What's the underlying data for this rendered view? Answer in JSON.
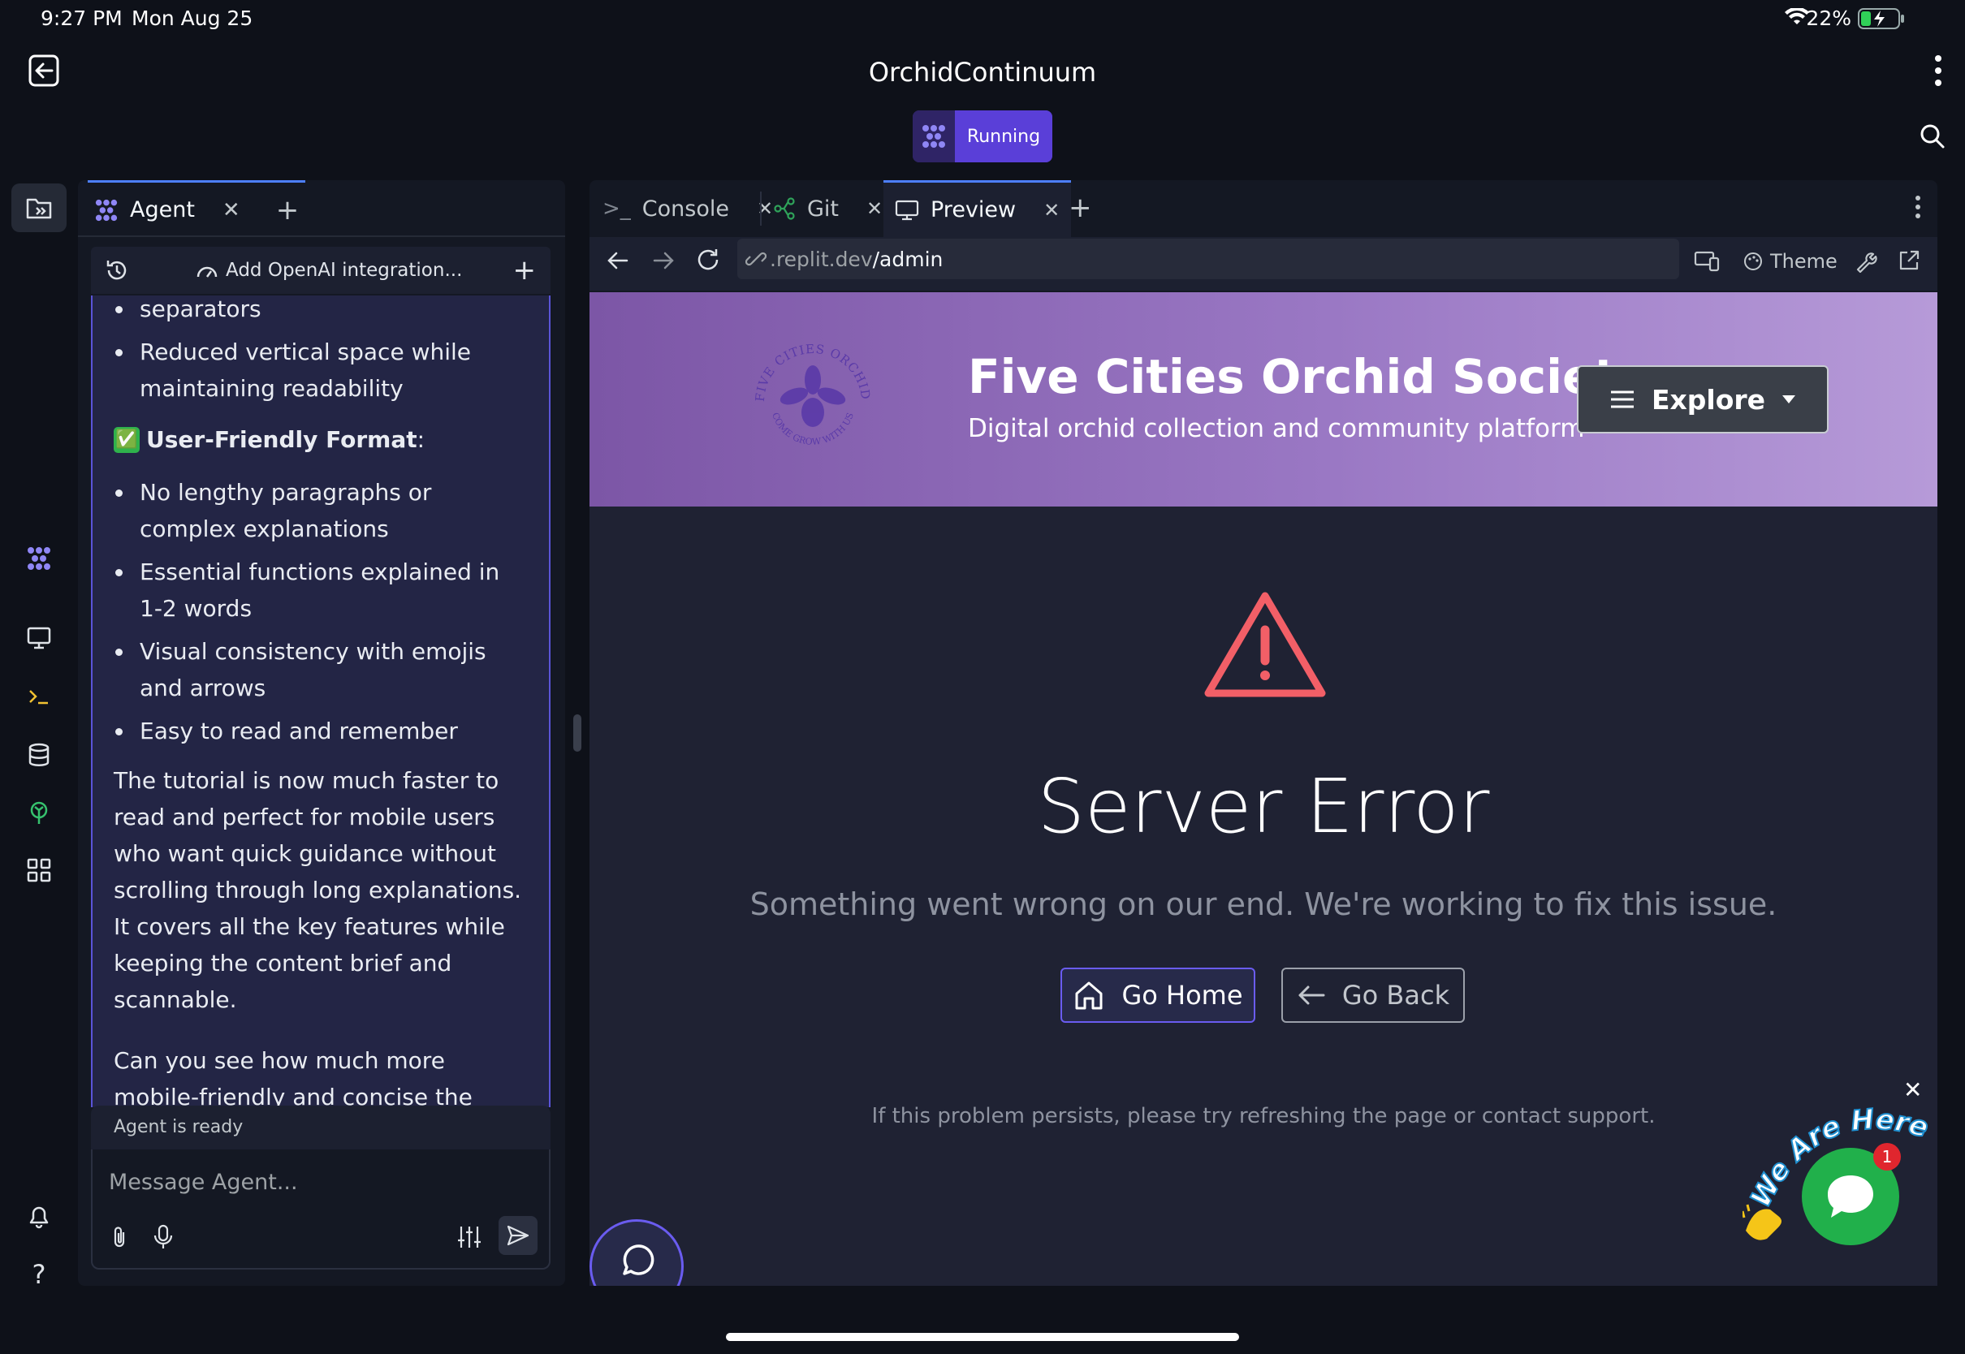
{
  "status_bar": {
    "time": "9:27 PM",
    "date": "Mon Aug 25",
    "battery": "22%"
  },
  "app": {
    "title": "OrchidContinuum",
    "run_status": "Running"
  },
  "agent_panel": {
    "tab_label": "Agent",
    "thread_title": "Add OpenAI integration...",
    "messages": {
      "partial_bullet": "separators",
      "bullet_reduced": "Reduced vertical space while maintaining readability",
      "heading_emoji": "✅",
      "heading": "User-Friendly Format",
      "heading_colon": ":",
      "bullets": [
        "No lengthy paragraphs or complex explanations",
        "Essential functions explained in 1-2 words",
        "Visual consistency with emojis and arrows",
        "Easy to read and remember"
      ],
      "paragraph_1": "The tutorial is now much faster to read and perfect for mobile users who want quick guidance without scrolling through long explanations. It covers all the key features while keeping the content brief and scannable.",
      "paragraph_2": "Can you see how much more mobile-friendly and concise the tutorial has"
    },
    "status": "Agent is ready",
    "input_placeholder": "Message Agent..."
  },
  "preview_panel": {
    "tabs": [
      {
        "label": "Console",
        "icon": "terminal-icon"
      },
      {
        "label": "Git",
        "icon": "git-icon"
      },
      {
        "label": "Preview",
        "icon": "monitor-icon"
      }
    ],
    "url": {
      "prefix": ".replit.dev",
      "path": "/admin"
    },
    "theme_label": "Theme"
  },
  "site": {
    "title": "Five Cities Orchid Society",
    "subtitle": "Digital orchid collection and community platform",
    "logo_text_top": "FIVE CITIES ORCHID SOCIETY",
    "logo_text_bottom": "COME GROW WITH US",
    "explore_label": "Explore",
    "error_title": "Server Error",
    "error_message": "Something went wrong on our end. We're working to fix this issue.",
    "go_home_label": "Go Home",
    "go_back_label": "Go Back",
    "footer_note": "If this problem persists, please try refreshing the page or contact support.",
    "chat_widget_text": "We Are Here!",
    "chat_badge_count": "1"
  },
  "colors": {
    "accent": "#5a3fd8",
    "error": "#f25f67",
    "chat_green": "#21b04b",
    "header_purple": "#9a78c4"
  }
}
